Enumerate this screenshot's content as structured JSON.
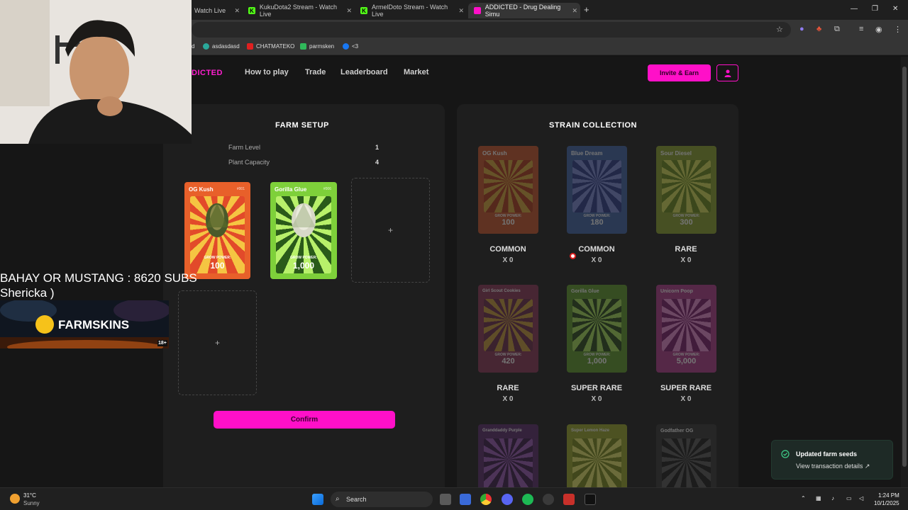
{
  "browser": {
    "tabs": [
      {
        "title": "Watch Live",
        "active": false
      },
      {
        "title": "KukuDota2 Stream - Watch Live",
        "active": false
      },
      {
        "title": "ArmelDoto Stream - Watch Live",
        "active": false
      },
      {
        "title": "ADDICTED - Drug Dealing Simu",
        "active": true
      }
    ],
    "bookmarks": [
      "d",
      "asdasdasd",
      "CHATMATEKO",
      "parmsken",
      "<3"
    ]
  },
  "nav": {
    "brand": "DICTED",
    "links": [
      "How to play",
      "Trade",
      "Leaderboard",
      "Market"
    ],
    "invite_label": "Invite & Earn"
  },
  "farm": {
    "title": "FARM SETUP",
    "level_label": "Farm Level",
    "level_value": "1",
    "capacity_label": "Plant Capacity",
    "capacity_value": "4",
    "cards": [
      {
        "name": "OG Kush",
        "num": "#001",
        "power_label": "GROW POWER:",
        "power": "100",
        "color": "#e8602a"
      },
      {
        "name": "Gorilla Glue",
        "num": "#006",
        "power_label": "GROW POWER:",
        "power": "1,000",
        "color": "#7ed03a"
      }
    ],
    "slot_plus": "+",
    "confirm_label": "Confirm"
  },
  "collection": {
    "title": "STRAIN COLLECTION",
    "strains": [
      {
        "name": "OG Kush",
        "power_label": "GROW POWER:",
        "power": "100",
        "rarity": "COMMON",
        "count": "X 0",
        "color": "#c9542a"
      },
      {
        "name": "Blue Dream",
        "power_label": "GROW POWER:",
        "power": "180",
        "rarity": "COMMON",
        "count": "X 0",
        "color": "#3f63a6"
      },
      {
        "name": "Sour Diesel",
        "power_label": "GROW POWER:",
        "power": "300",
        "rarity": "RARE",
        "count": "X 0",
        "color": "#8aa12c"
      },
      {
        "name": "Girl Scout Cookies",
        "power_label": "GROW POWER:",
        "power": "420",
        "rarity": "RARE",
        "count": "X 0",
        "color": "#8a3555"
      },
      {
        "name": "Gorilla Glue",
        "power_label": "GROW POWER:",
        "power": "1,000",
        "rarity": "SUPER RARE",
        "count": "X 0",
        "color": "#5f9a2a"
      },
      {
        "name": "Unicorn Poop",
        "power_label": "GROW POWER:",
        "power": "5,000",
        "rarity": "SUPER RARE",
        "count": "X 0",
        "color": "#b03a8a"
      },
      {
        "name": "Granddaddy Purple",
        "power_label": "",
        "power": "",
        "rarity": "",
        "count": "",
        "color": "#5a2a6a"
      },
      {
        "name": "Super Lemon Haze",
        "power_label": "",
        "power": "",
        "rarity": "",
        "count": "",
        "color": "#9aa82a"
      },
      {
        "name": "Godfather OG",
        "power_label": "",
        "power": "",
        "rarity": "",
        "count": "",
        "color": "#333333"
      }
    ]
  },
  "toast": {
    "title": "Updated farm seeds",
    "link": "View transaction details"
  },
  "stream": {
    "overlay_line1": "BAHAY OR MUSTANG : 8620 SUBS",
    "overlay_line2": "Shericka )",
    "banner_brand": "FARMSKINS",
    "banner_age": "18+"
  },
  "taskbar": {
    "weather_temp": "31°C",
    "weather_desc": "Sunny",
    "search_label": "Search",
    "time": "1:24 PM",
    "date": "10/1/2025"
  }
}
